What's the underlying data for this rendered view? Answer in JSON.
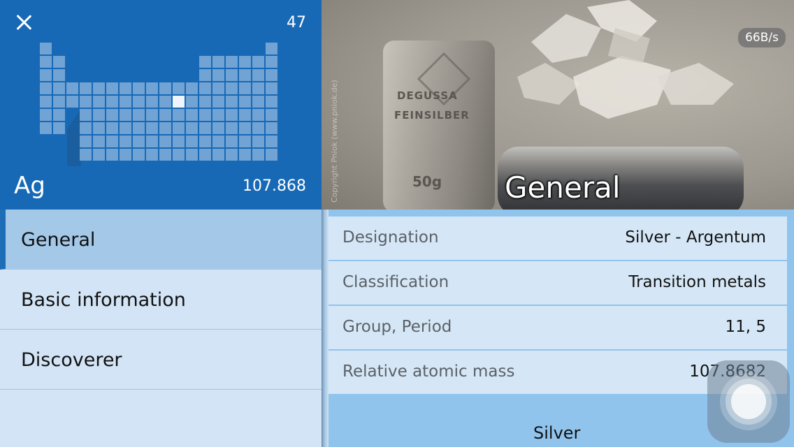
{
  "element": {
    "atomic_number": "47",
    "symbol": "Ag",
    "atomic_weight": "107.868",
    "highlighted_position": {
      "group": 11,
      "period": 5
    }
  },
  "photo": {
    "title": "General",
    "copyright": "Copyright Pniok (www.pniok.de)",
    "bar_line1": "DEGUSSA",
    "bar_line2": "FEINSILBER",
    "bar_line3": "50g"
  },
  "status": {
    "network_speed": "66B/s"
  },
  "menu": {
    "items": [
      {
        "label": "General",
        "active": true
      },
      {
        "label": "Basic information",
        "active": false
      },
      {
        "label": "Discoverer",
        "active": false
      }
    ]
  },
  "details": {
    "rows": [
      {
        "label": "Designation",
        "value": "Silver - Argentum"
      },
      {
        "label": "Classification",
        "value": "Transition metals"
      },
      {
        "label": "Group, Period",
        "value": "11, 5"
      },
      {
        "label": "Relative atomic mass",
        "value": "107.8682"
      }
    ],
    "footer_name": "Silver"
  },
  "icons": {
    "close": "close-icon",
    "assistive_touch": "assistive-touch-icon"
  },
  "colors": {
    "header_blue": "#1769b5",
    "cell_blue": "#71a3d4",
    "menu_bg": "#d2e4f5",
    "menu_active": "#a4c8e8",
    "details_bg": "#91c4ec"
  }
}
